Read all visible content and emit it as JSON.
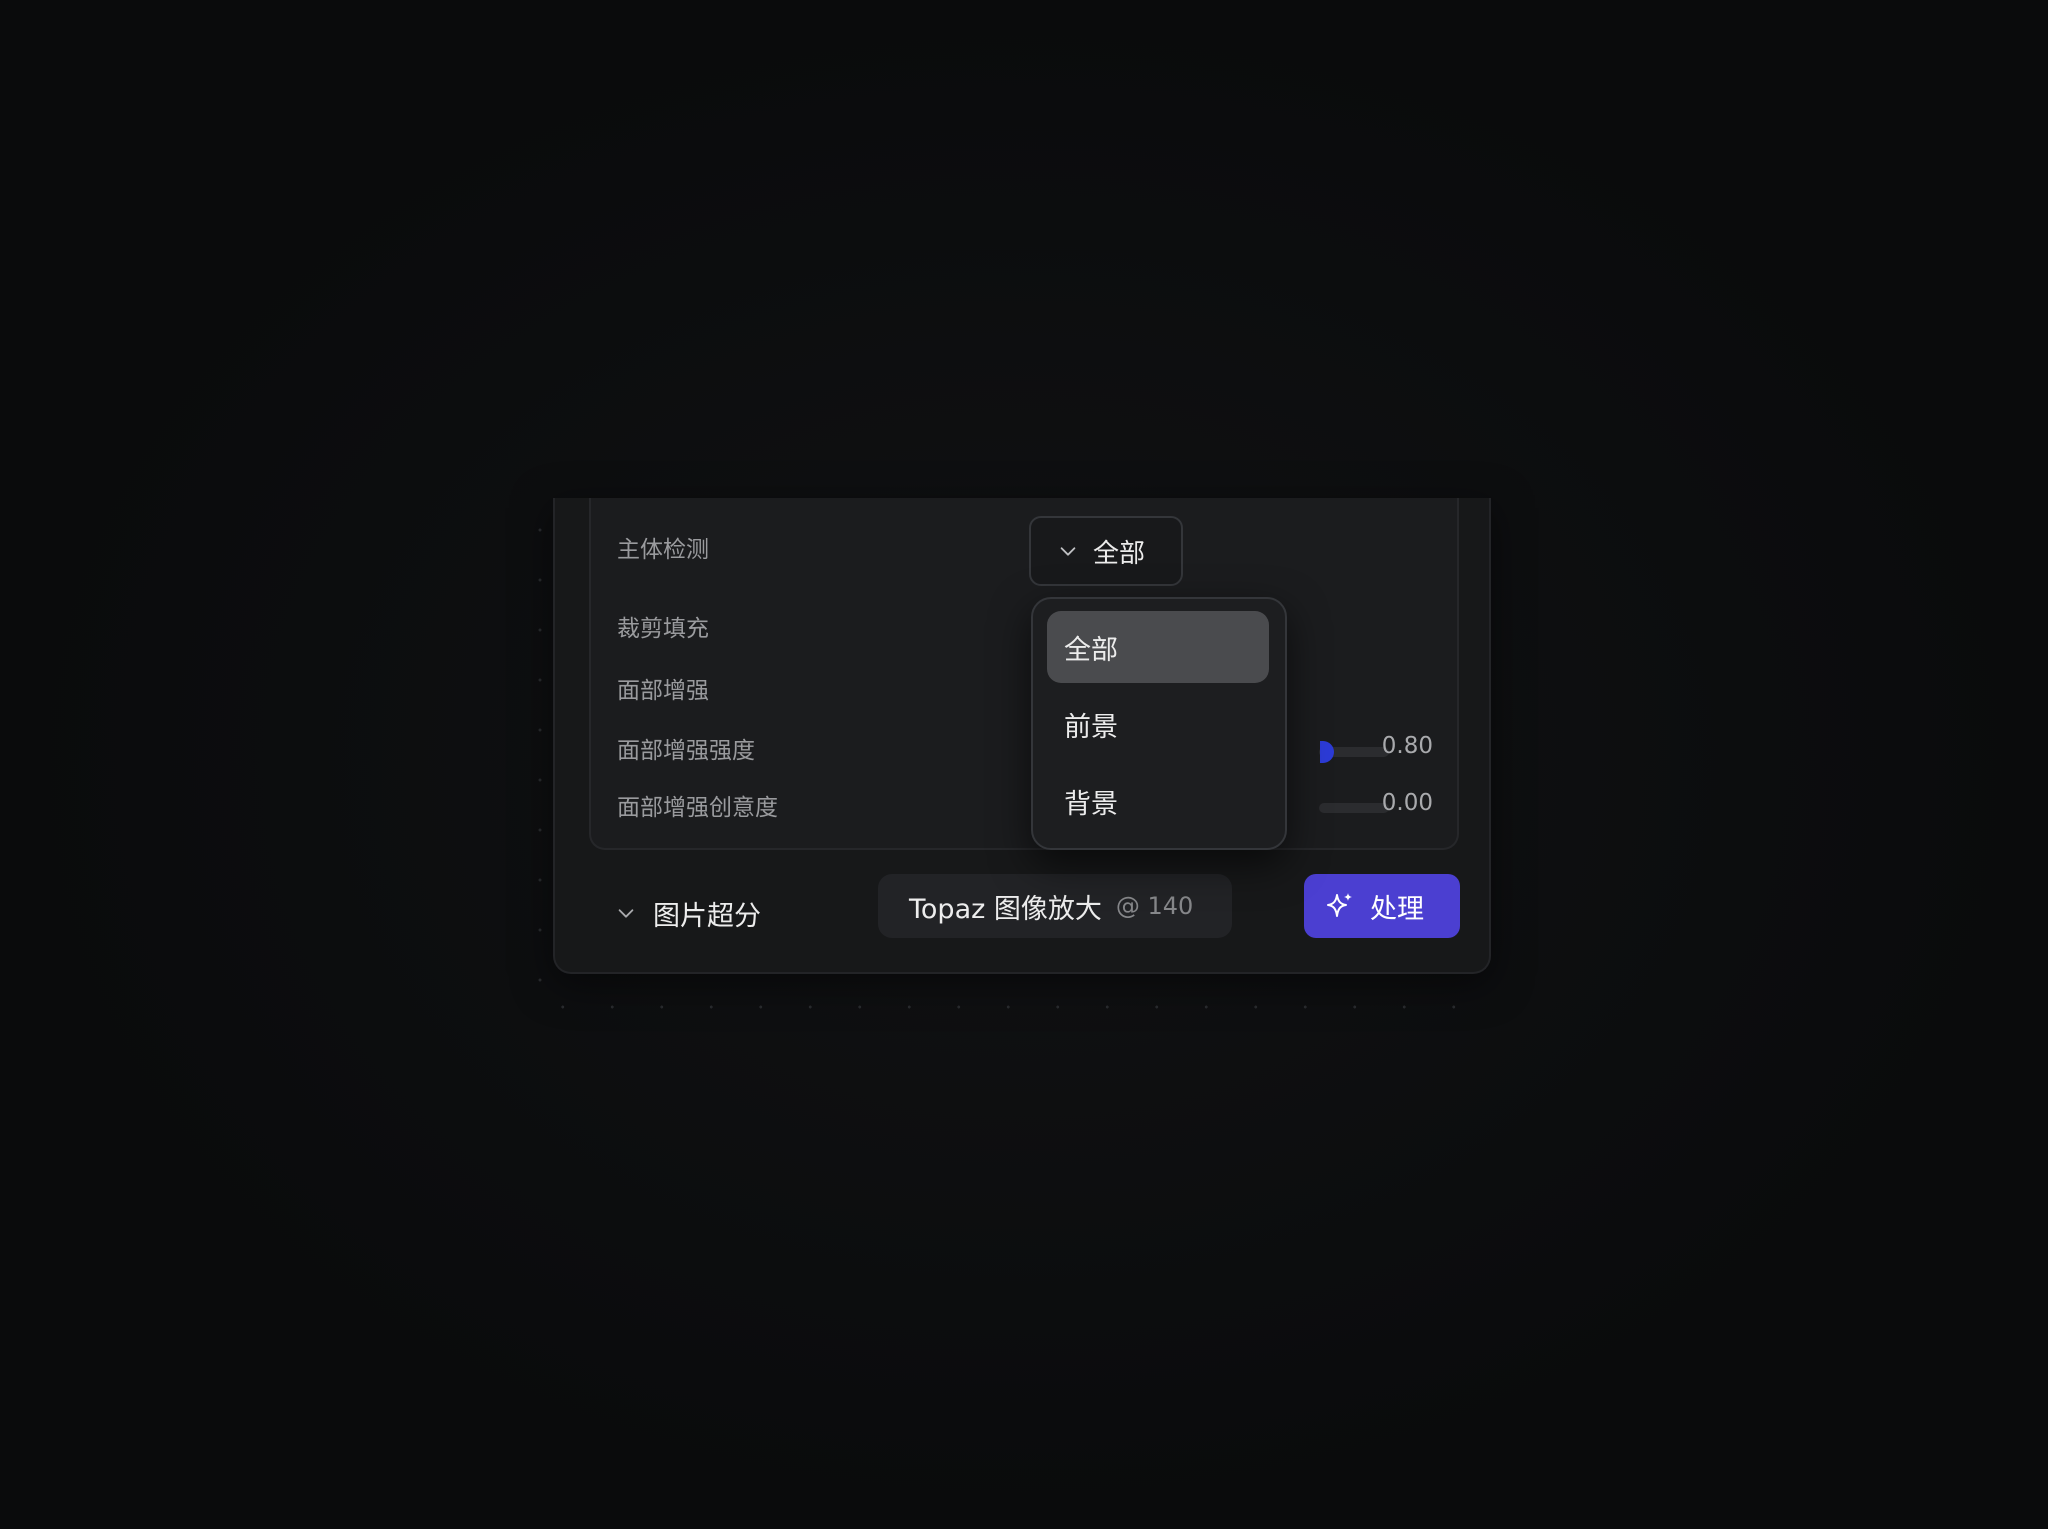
{
  "settings": {
    "subject_detection": {
      "label": "主体检测",
      "selected": "全部"
    },
    "crop_fill": {
      "label": "裁剪填充"
    },
    "face_enhance": {
      "label": "面部增强"
    },
    "face_enhance_strength": {
      "label": "面部增强强度",
      "value": "0.80"
    },
    "face_enhance_creativity": {
      "label": "面部增强创意度",
      "value": "0.00"
    }
  },
  "dropdown": {
    "options": [
      {
        "label": "全部",
        "selected": true
      },
      {
        "label": "前景",
        "selected": false
      },
      {
        "label": "背景",
        "selected": false
      }
    ]
  },
  "bottom_bar": {
    "section_label": "图片超分",
    "model_name": "Topaz 图像放大",
    "model_cost": "@ 140",
    "process_label": "处理"
  },
  "colors": {
    "accent": "#4b3fd1",
    "slider_knob": "#2c3bd6",
    "background": "#0b0c0d"
  },
  "icons": {
    "select_chevron": "chevron-down-icon",
    "section_chevron": "chevron-down-icon",
    "process_icon": "sparkles-icon"
  }
}
